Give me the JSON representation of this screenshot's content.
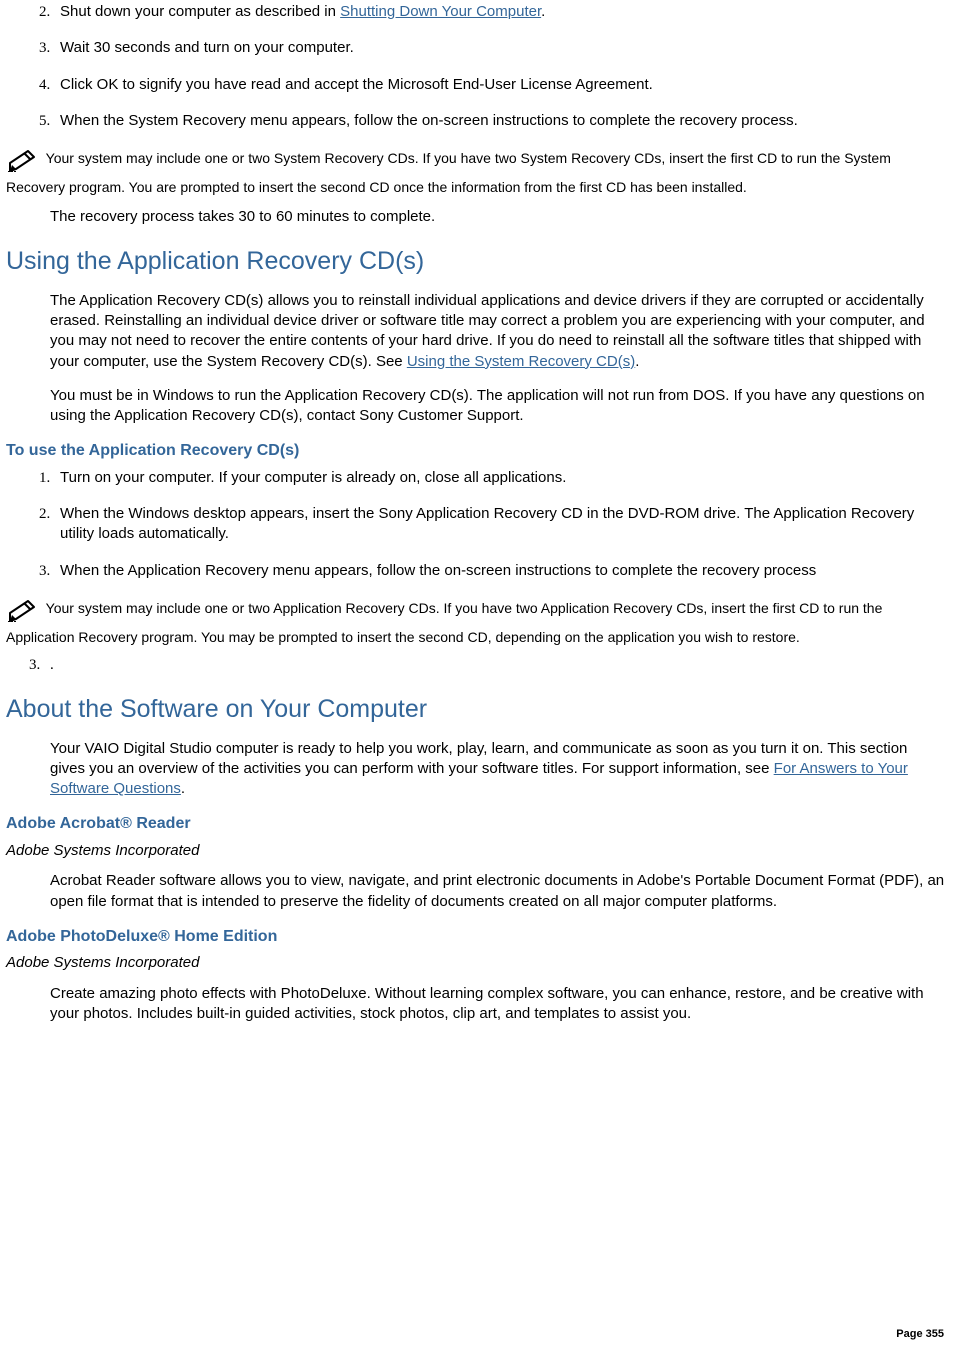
{
  "list1": {
    "item2_a": "Shut down your computer as described in ",
    "item2_link": "Shutting Down Your Computer",
    "item2_b": ".",
    "item3": "Wait 30 seconds and turn on your computer.",
    "item4": "Click OK to signify you have read and accept the Microsoft End-User License Agreement.",
    "item5": "When the System Recovery menu appears, follow the on-screen instructions to complete the recovery process."
  },
  "note1": " Your system may include one or two System Recovery CDs. If you have two System Recovery CDs, insert the first CD to run the System Recovery program. You are prompted to insert the second CD once the information from the first CD has been installed.",
  "indent1": "The recovery process takes 30 to 60 minutes to complete.",
  "sec_apprec": {
    "title": "Using the Application Recovery CD(s)",
    "p1_a": "The Application Recovery CD(s) allows you to reinstall individual applications and device drivers if they are corrupted or accidentally erased. Reinstalling an individual device driver or software title may correct a problem you are experiencing with your computer, and you may not need to recover the entire contents of your hard drive. If you do need to reinstall all the software titles that shipped with your computer, use the System Recovery CD(s). See ",
    "p1_link": "Using the System Recovery CD(s)",
    "p1_b": ".",
    "p2": "You must be in Windows to run the Application Recovery CD(s). The application will not run from DOS. If you have any questions on using the Application Recovery CD(s), contact Sony Customer Support.",
    "sub_title": "To use the Application Recovery CD(s)",
    "steps": {
      "s1": "Turn on your computer. If your computer is already on, close all applications.",
      "s2": "When the Windows desktop appears, insert the Sony Application Recovery CD in the DVD-ROM drive. The Application Recovery utility loads automatically.",
      "s3": "When the Application Recovery menu appears, follow the on-screen instructions to complete the recovery process"
    },
    "note2": " Your system may include one or two Application Recovery CDs. If you have two Application Recovery CDs, insert the first CD to run the Application Recovery program. You may be prompted to insert the second CD, depending on the application you wish to restore.",
    "list3_item": "."
  },
  "sec_about": {
    "title": "About the Software on Your Computer",
    "p1_a": "Your VAIO Digital Studio computer is ready to help you work, play, learn, and communicate as soon as you turn it on. This section gives you an overview of the activities you can perform with your software titles. For support information, see ",
    "p1_link": "For Answers to Your Software Questions",
    "p1_b": "."
  },
  "sw_acrobat": {
    "title": "Adobe Acrobat® Reader",
    "company": "Adobe Systems Incorporated",
    "body": "Acrobat Reader software allows you to view, navigate, and print electronic documents in Adobe's Portable Document Format (PDF), an open file format that is intended to preserve the fidelity of documents created on all major computer platforms."
  },
  "sw_photodeluxe": {
    "title": "Adobe PhotoDeluxe® Home Edition",
    "company": "Adobe Systems Incorporated",
    "body": "Create amazing photo effects with PhotoDeluxe. Without learning complex software, you can enhance, restore, and be creative with your photos. Includes built-in guided activities, stock photos, clip art, and templates to assist you."
  },
  "page_number": "Page 355"
}
